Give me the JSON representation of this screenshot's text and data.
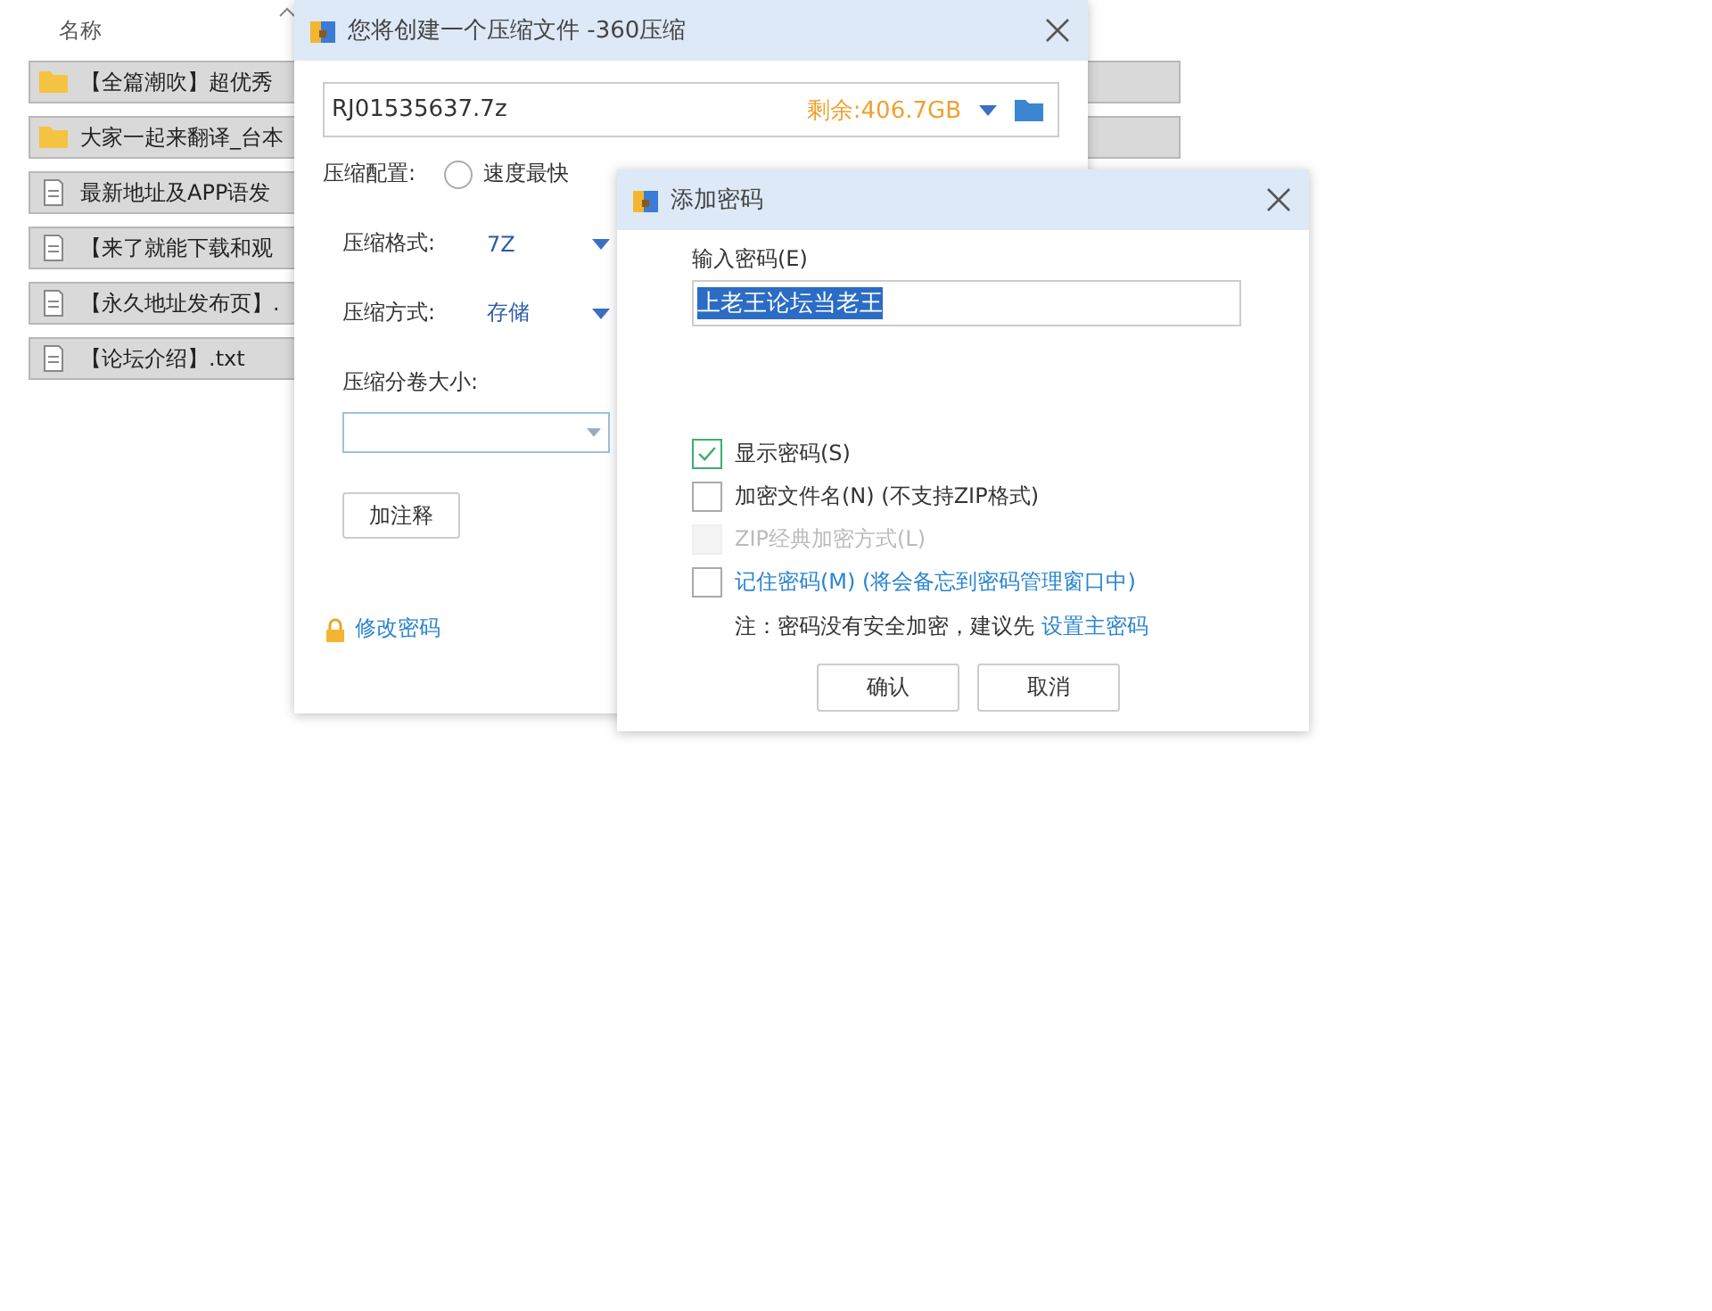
{
  "file_list": {
    "header": "名称",
    "rows": [
      {
        "kind": "folder",
        "name": "【全篇潮吹】超优秀"
      },
      {
        "kind": "folder",
        "name": "大家一起来翻译_台本"
      },
      {
        "kind": "file",
        "name": "最新地址及APP语发"
      },
      {
        "kind": "file",
        "name": "【来了就能下载和观"
      },
      {
        "kind": "file",
        "name": "【永久地址发布页】."
      },
      {
        "kind": "file",
        "name": "【论坛介绍】.txt"
      }
    ]
  },
  "compress_dialog": {
    "title": "您将创建一个压缩文件 -360压缩",
    "filename": "RJ01535637.7z",
    "free_space": "剩余:406.7GB",
    "config_label": "压缩配置:",
    "config_options": [
      {
        "label": "速度最快",
        "selected": false
      }
    ],
    "format_label": "压缩格式:",
    "format_value": "7Z",
    "method_label": "压缩方式:",
    "method_value": "存储",
    "volume_label": "压缩分卷大小:",
    "comment_button": "加注释",
    "change_password_link": "修改密码"
  },
  "password_dialog": {
    "title": "添加密码",
    "input_label": "输入密码(E)",
    "password": "上老王论坛当老王",
    "options": [
      {
        "kind": "plain",
        "label": "显示密码(S)",
        "checked": true,
        "disabled": false
      },
      {
        "kind": "plain",
        "label": "加密文件名(N) (不支持ZIP格式)",
        "checked": false,
        "disabled": false
      },
      {
        "kind": "plain",
        "label": "ZIP经典加密方式(L)",
        "checked": false,
        "disabled": true
      },
      {
        "kind": "link",
        "label": "记住密码(M) (将会备忘到密码管理窗口中)",
        "checked": false,
        "disabled": false
      }
    ],
    "note": "注：密码没有安全加密，建议先",
    "note_link": "设置主密码",
    "buttons": [
      "确认",
      "取消"
    ]
  }
}
